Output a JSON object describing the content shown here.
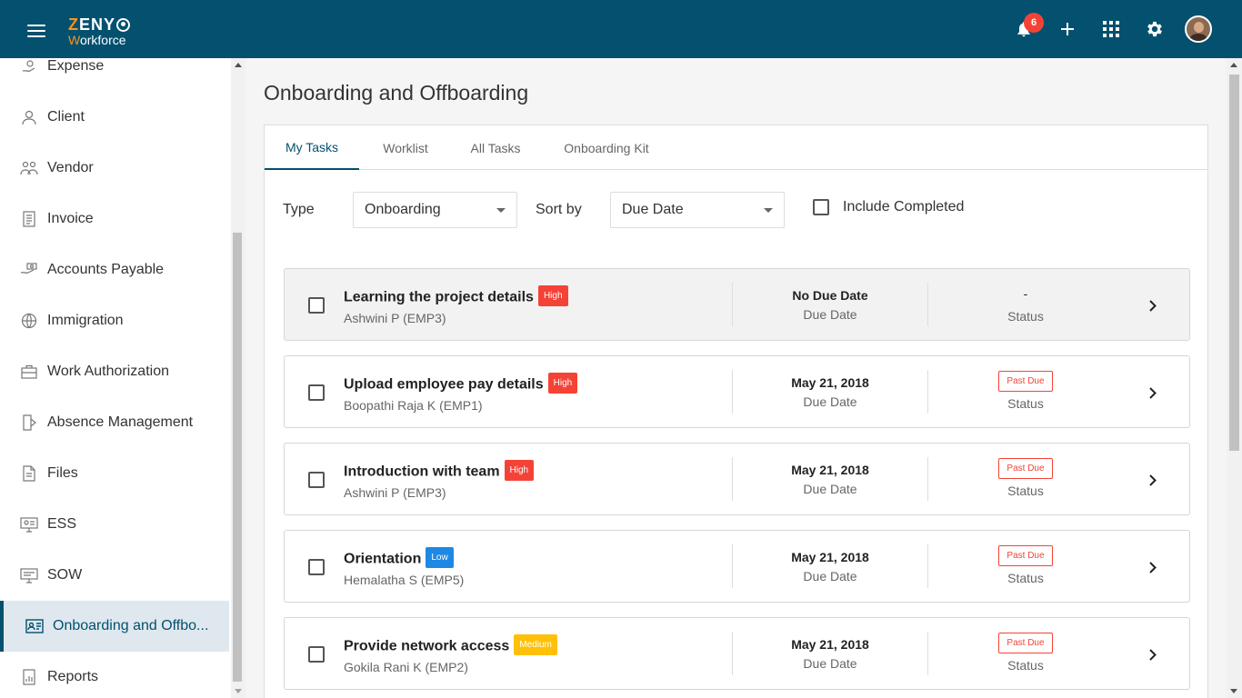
{
  "app": {
    "logo_line1": "ZENY",
    "logo_line1_first": "Z",
    "logo_line1_rest": "ENY",
    "logo_line2_first": "W",
    "logo_line2_rest": "orkforce",
    "notification_count": "6"
  },
  "colors": {
    "header": "#03506f",
    "accent": "#03506f",
    "high": "#f44336",
    "low": "#1e88e5",
    "medium": "#ffc107",
    "past_due": "#f44336"
  },
  "sidebar": {
    "items": [
      {
        "label": "Expense",
        "icon": "expense-icon"
      },
      {
        "label": "Client",
        "icon": "client-icon"
      },
      {
        "label": "Vendor",
        "icon": "vendor-icon"
      },
      {
        "label": "Invoice",
        "icon": "invoice-icon"
      },
      {
        "label": "Accounts Payable",
        "icon": "accounts-payable-icon"
      },
      {
        "label": "Immigration",
        "icon": "immigration-icon"
      },
      {
        "label": "Work Authorization",
        "icon": "briefcase-icon"
      },
      {
        "label": "Absence Management",
        "icon": "absence-icon"
      },
      {
        "label": "Files",
        "icon": "files-icon"
      },
      {
        "label": "ESS",
        "icon": "ess-icon"
      },
      {
        "label": "SOW",
        "icon": "sow-icon"
      },
      {
        "label": "Onboarding and Offbo...",
        "icon": "id-card-icon",
        "active": true
      },
      {
        "label": "Reports",
        "icon": "reports-icon"
      }
    ]
  },
  "main": {
    "title": "Onboarding and Offboarding",
    "tabs": [
      {
        "label": "My Tasks",
        "active": true
      },
      {
        "label": "Worklist"
      },
      {
        "label": "All Tasks"
      },
      {
        "label": "Onboarding Kit"
      }
    ],
    "filters": {
      "type_label": "Type",
      "type_value": "Onboarding",
      "sort_label": "Sort by",
      "sort_value": "Due Date",
      "include_completed_label": "Include Completed"
    },
    "due_label": "Due Date",
    "status_label": "Status",
    "tasks": [
      {
        "name": "Learning the project details",
        "priority": "High",
        "employee": "Ashwini P (EMP3)",
        "due": "No Due Date",
        "status": "-"
      },
      {
        "name": "Upload employee pay details",
        "priority": "High",
        "employee": "Boopathi Raja K (EMP1)",
        "due": "May 21, 2018",
        "status": "Past Due"
      },
      {
        "name": "Introduction with team",
        "priority": "High",
        "employee": "Ashwini P (EMP3)",
        "due": "May 21, 2018",
        "status": "Past Due"
      },
      {
        "name": "Orientation",
        "priority": "Low",
        "employee": "Hemalatha S (EMP5)",
        "due": "May 21, 2018",
        "status": "Past Due"
      },
      {
        "name": "Provide network access",
        "priority": "Medium",
        "employee": "Gokila Rani K (EMP2)",
        "due": "May 21, 2018",
        "status": "Past Due"
      }
    ]
  }
}
